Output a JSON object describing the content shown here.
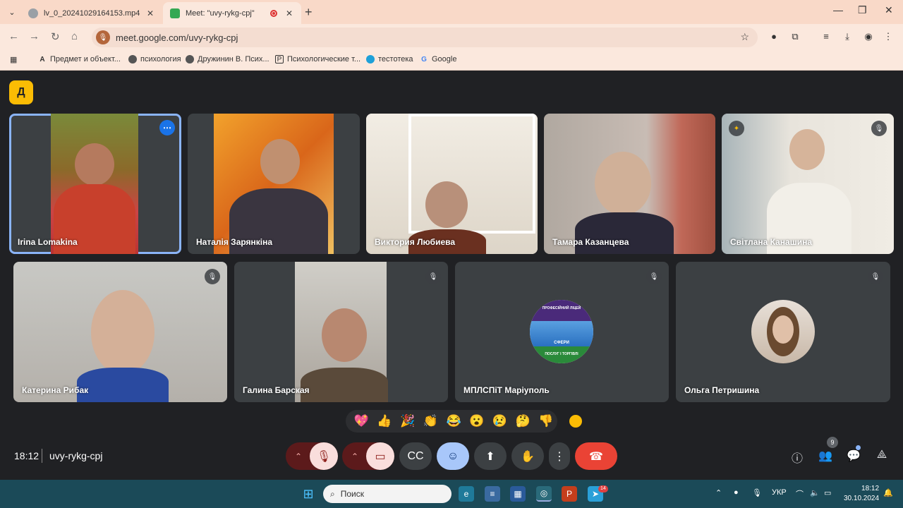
{
  "browser": {
    "tabs": [
      {
        "title": "lv_0_20241029164153.mp4",
        "close": "✕"
      },
      {
        "title": "Meet: \"uvy-rykg-cpj\"",
        "close": "✕"
      }
    ],
    "new_tab": "+",
    "window_controls": {
      "minimize": "—",
      "maximize": "❐",
      "close": "✕"
    },
    "url": "meet.google.com/uvy-rykg-cpj",
    "bookmarks": [
      "Предмет и объект...",
      "психология",
      "Дружинин В. Псих...",
      "Психологические т...",
      "тестотека",
      "Google"
    ]
  },
  "participants": [
    {
      "name": "Irina Lomakina"
    },
    {
      "name": "Наталія Зарянкіна"
    },
    {
      "name": "Виктория Любиева"
    },
    {
      "name": "Тамара Казанцева"
    },
    {
      "name": "Світлана Канашина"
    },
    {
      "name": "Катерина Рибак"
    },
    {
      "name": "Галина Барская"
    },
    {
      "name": "МПЛСПіТ Маріуполь"
    },
    {
      "name": "Ольга Петришина"
    }
  ],
  "logo_text": {
    "top": "ПРОФЕСІЙНИЙ ЛІЦЕЙ",
    "mid": "СФЕРИ",
    "bottom": "ПОСЛУГ І ТОРГІВЛІ"
  },
  "reactions": [
    "💖",
    "👍",
    "🎉",
    "👏",
    "😂",
    "😮",
    "😢",
    "🤔",
    "👎"
  ],
  "meeting": {
    "time": "18:12",
    "code": "uvy-rykg-cpj"
  },
  "people_count": "9",
  "taskbar": {
    "search_placeholder": "Поиск",
    "language": "УКР",
    "clock_time": "18:12",
    "clock_date": "30.10.2024",
    "telegram_badge": "14"
  },
  "colors": {
    "meet_bg": "#202124",
    "tile_bg": "#3c4043",
    "end_call": "#ea4335",
    "accent_blue": "#8ab4f8"
  }
}
